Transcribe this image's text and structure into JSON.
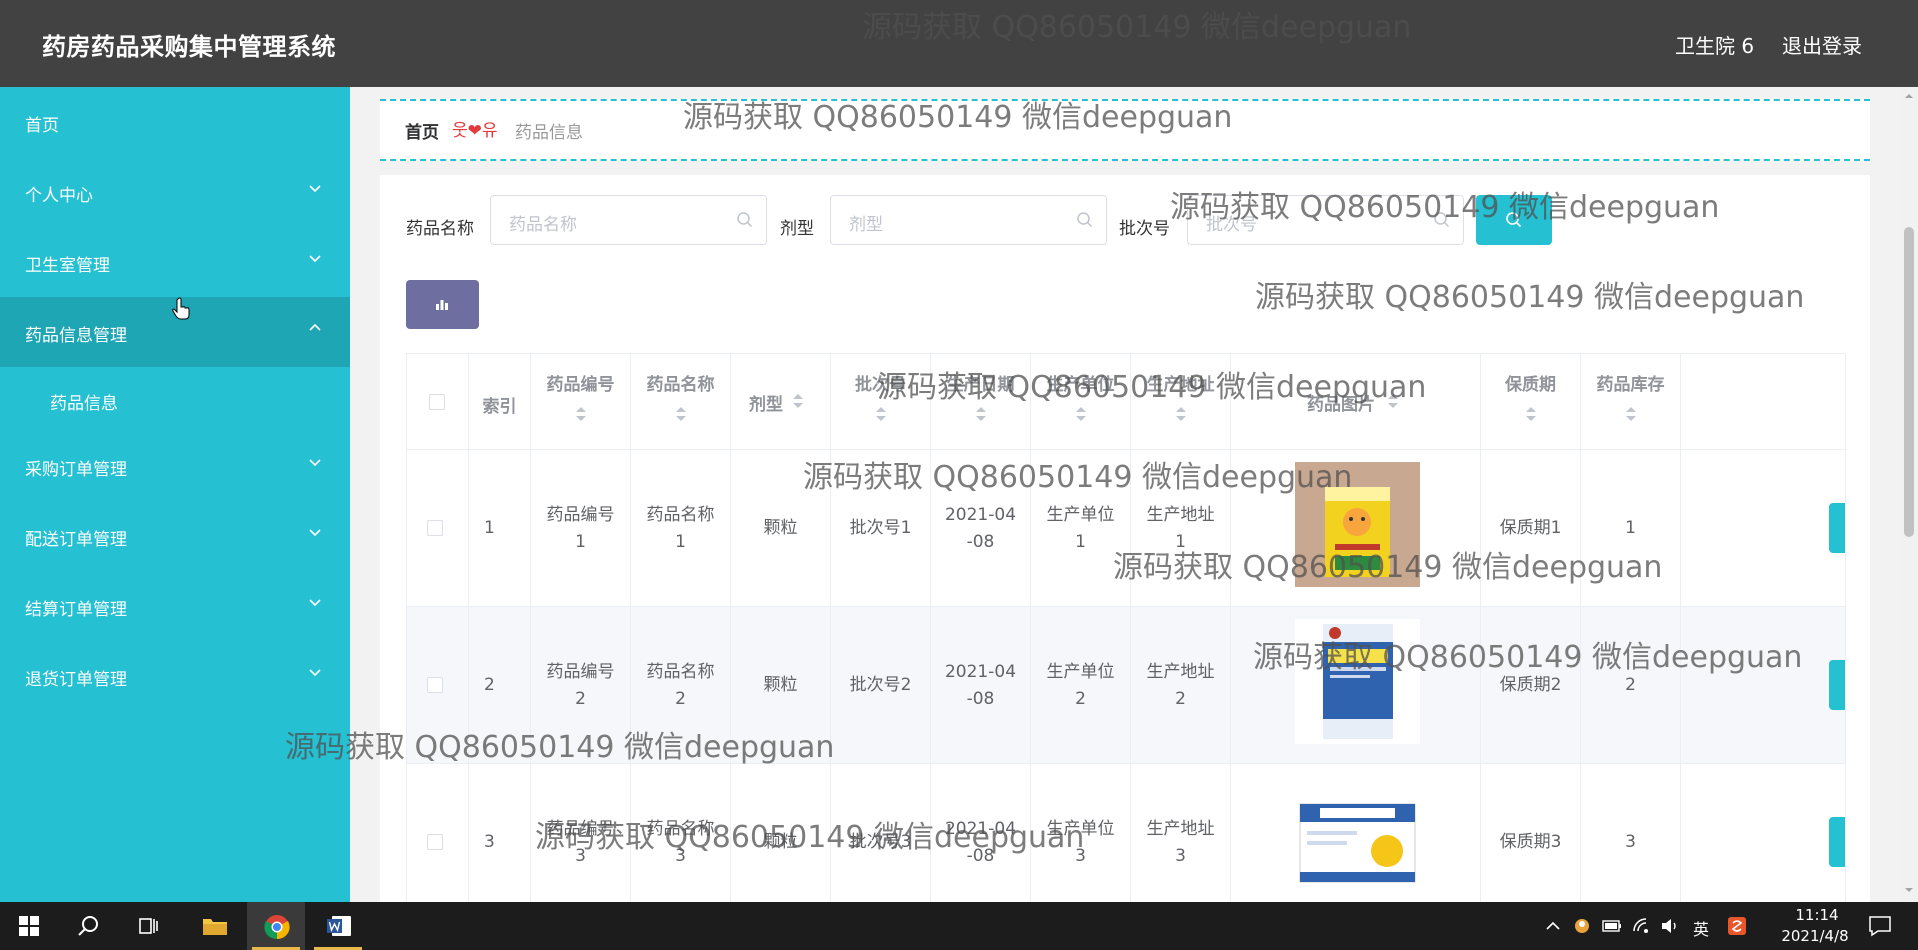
{
  "header": {
    "app_title": "药房药品采购集中管理系统",
    "user_name": "卫生院 6",
    "logout_label": "退出登录"
  },
  "sidebar": {
    "items": [
      {
        "label": "首页"
      },
      {
        "label": "个人中心"
      },
      {
        "label": "卫生室管理"
      },
      {
        "label": "药品信息管理"
      },
      {
        "label": "采购订单管理"
      },
      {
        "label": "配送订单管理"
      },
      {
        "label": "结算订单管理"
      },
      {
        "label": "退货订单管理"
      }
    ],
    "active_item": "药品信息管理",
    "sub_items": [
      {
        "label": "药品信息"
      }
    ]
  },
  "breadcrumb": {
    "home": "首页",
    "separator": "웃❤유",
    "current": "药品信息"
  },
  "search": {
    "name_label": "药品名称",
    "name_placeholder": "药品名称",
    "form_label": "剂型",
    "form_placeholder": "剂型",
    "batch_label": "批次号",
    "batch_placeholder": "批次号"
  },
  "table": {
    "columns": [
      "索引",
      "药品编号",
      "药品名称",
      "剂型",
      "批次号",
      "生产日期",
      "生产单位",
      "生产地址",
      "药品图片",
      "保质期",
      "药品库存"
    ],
    "rows": [
      {
        "index": "1",
        "code": [
          "药品编号",
          "1"
        ],
        "name": [
          "药品名称",
          "1"
        ],
        "form": "颗粒",
        "batch": "批次号1",
        "date": [
          "2021-04",
          "-08"
        ],
        "unit": [
          "生产单位",
          "1"
        ],
        "addr": [
          "生产地址",
          "1"
        ],
        "shelf": "保质期1",
        "stock": "1"
      },
      {
        "index": "2",
        "code": [
          "药品编号",
          "2"
        ],
        "name": [
          "药品名称",
          "2"
        ],
        "form": "颗粒",
        "batch": "批次号2",
        "date": [
          "2021-04",
          "-08"
        ],
        "unit": [
          "生产单位",
          "2"
        ],
        "addr": [
          "生产地址",
          "2"
        ],
        "shelf": "保质期2",
        "stock": "2"
      },
      {
        "index": "3",
        "code": [
          "药品编号",
          "3"
        ],
        "name": [
          "药品名称",
          "3"
        ],
        "form": "颗粒",
        "batch": "批次号3",
        "date": [
          "2021-04",
          "-08"
        ],
        "unit": [
          "生产单位",
          "3"
        ],
        "addr": [
          "生产地址",
          "3"
        ],
        "shelf": "保质期3",
        "stock": "3"
      }
    ]
  },
  "watermark": "源码获取 QQ86050149 微信deepguan",
  "taskbar": {
    "tray_lang": "英",
    "time": "11:14",
    "date": "2021/4/8"
  },
  "colors": {
    "accent": "#25c1d2",
    "sidebar_active": "#1fa6b5",
    "header_bg": "#424242",
    "chart_button": "#6f6ea0"
  }
}
